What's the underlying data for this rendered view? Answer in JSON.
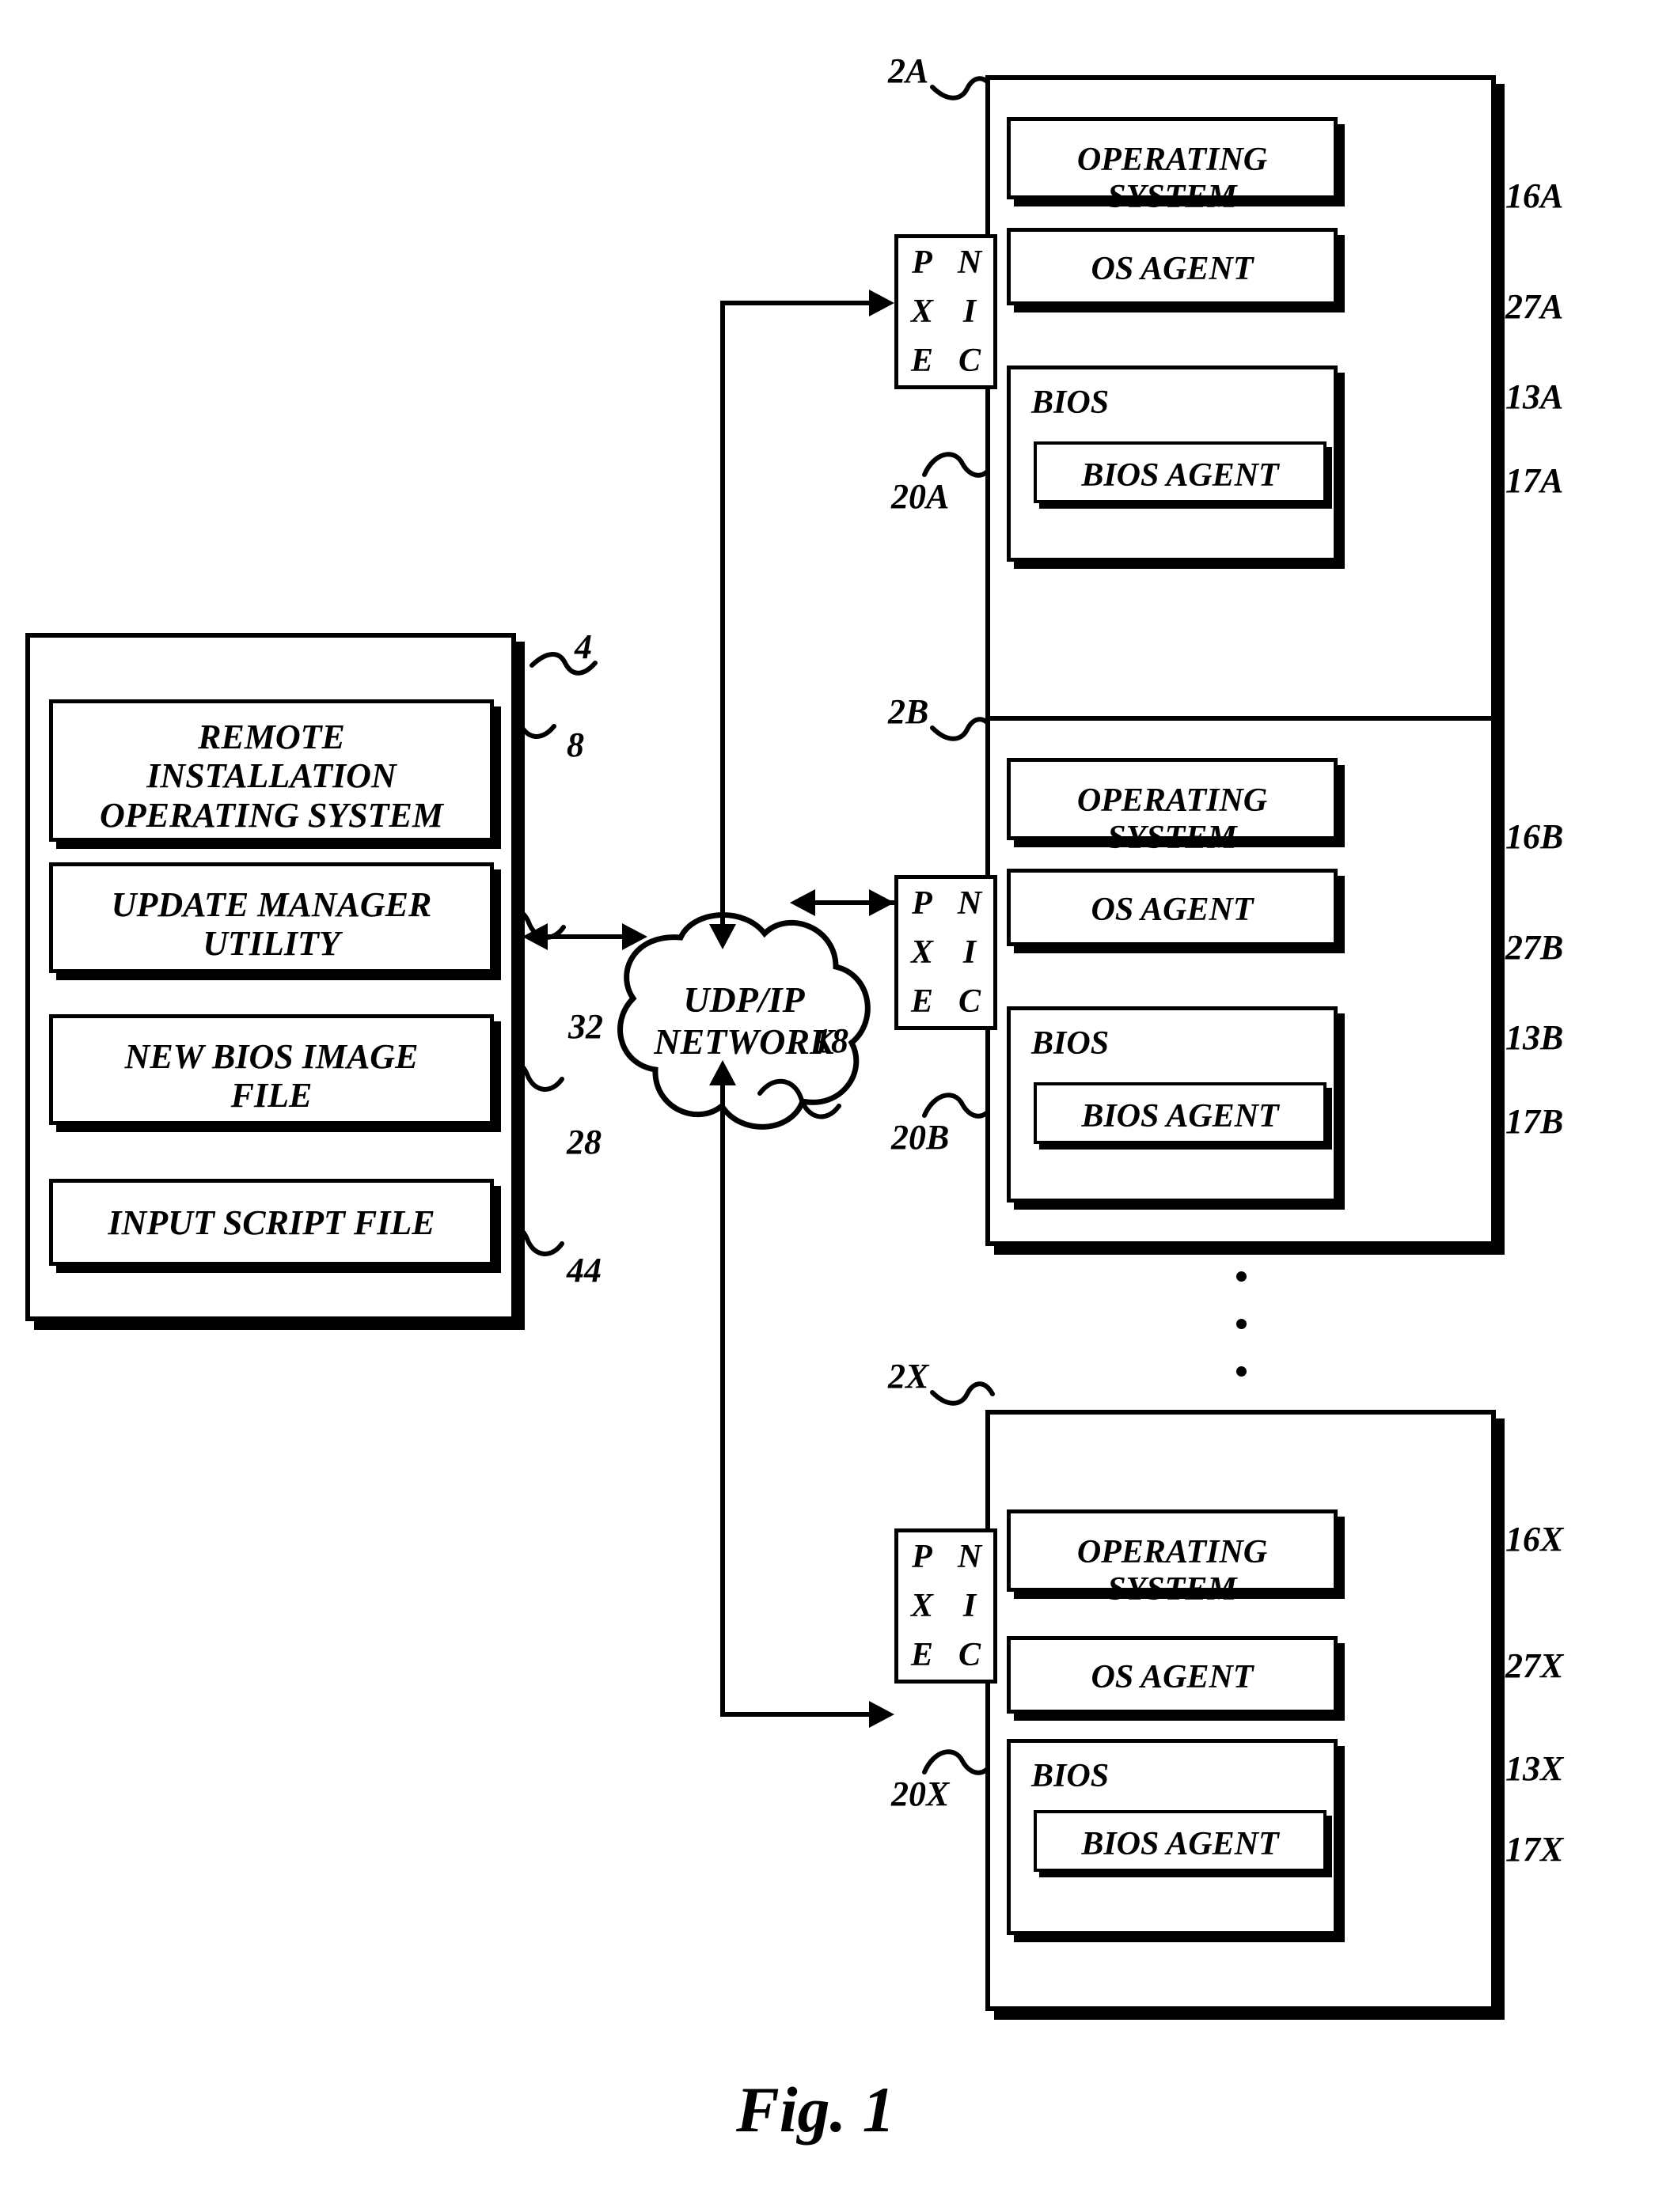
{
  "figure": {
    "caption": "Fig. 1"
  },
  "server": {
    "ref": "4",
    "items": [
      {
        "label": "REMOTE\nINSTALLATION\nOPERATING SYSTEM",
        "ref": "8"
      },
      {
        "label": "UPDATE MANAGER\nUTILITY",
        "ref": "32"
      },
      {
        "label": "NEW BIOS IMAGE\nFILE",
        "ref": "28"
      },
      {
        "label": "INPUT SCRIPT FILE",
        "ref": "44"
      }
    ]
  },
  "network": {
    "label": "UDP/IP\nNETWORK",
    "ref": "18"
  },
  "clients": [
    {
      "ref": "2A",
      "nic": {
        "col1": [
          "P",
          "X",
          "E"
        ],
        "col2": [
          "N",
          "I",
          "C"
        ],
        "ref": "20A"
      },
      "os": {
        "label": "OPERATING SYSTEM",
        "ref": "16A"
      },
      "os_agent": {
        "label": "OS AGENT",
        "ref": "27A"
      },
      "bios": {
        "label": "BIOS",
        "ref": "13A"
      },
      "bios_agent": {
        "label": "BIOS AGENT",
        "ref": "17A"
      }
    },
    {
      "ref": "2B",
      "nic": {
        "col1": [
          "P",
          "X",
          "E"
        ],
        "col2": [
          "N",
          "I",
          "C"
        ],
        "ref": "20B"
      },
      "os": {
        "label": "OPERATING SYSTEM",
        "ref": "16B"
      },
      "os_agent": {
        "label": "OS AGENT",
        "ref": "27B"
      },
      "bios": {
        "label": "BIOS",
        "ref": "13B"
      },
      "bios_agent": {
        "label": "BIOS AGENT",
        "ref": "17B"
      }
    },
    {
      "ref": "2X",
      "nic": {
        "col1": [
          "P",
          "X",
          "E"
        ],
        "col2": [
          "N",
          "I",
          "C"
        ],
        "ref": "20X"
      },
      "os": {
        "label": "OPERATING SYSTEM",
        "ref": "16X"
      },
      "os_agent": {
        "label": "OS AGENT",
        "ref": "27X"
      },
      "bios": {
        "label": "BIOS",
        "ref": "13X"
      },
      "bios_agent": {
        "label": "BIOS AGENT",
        "ref": "17X"
      }
    }
  ],
  "ellipsis": "•"
}
